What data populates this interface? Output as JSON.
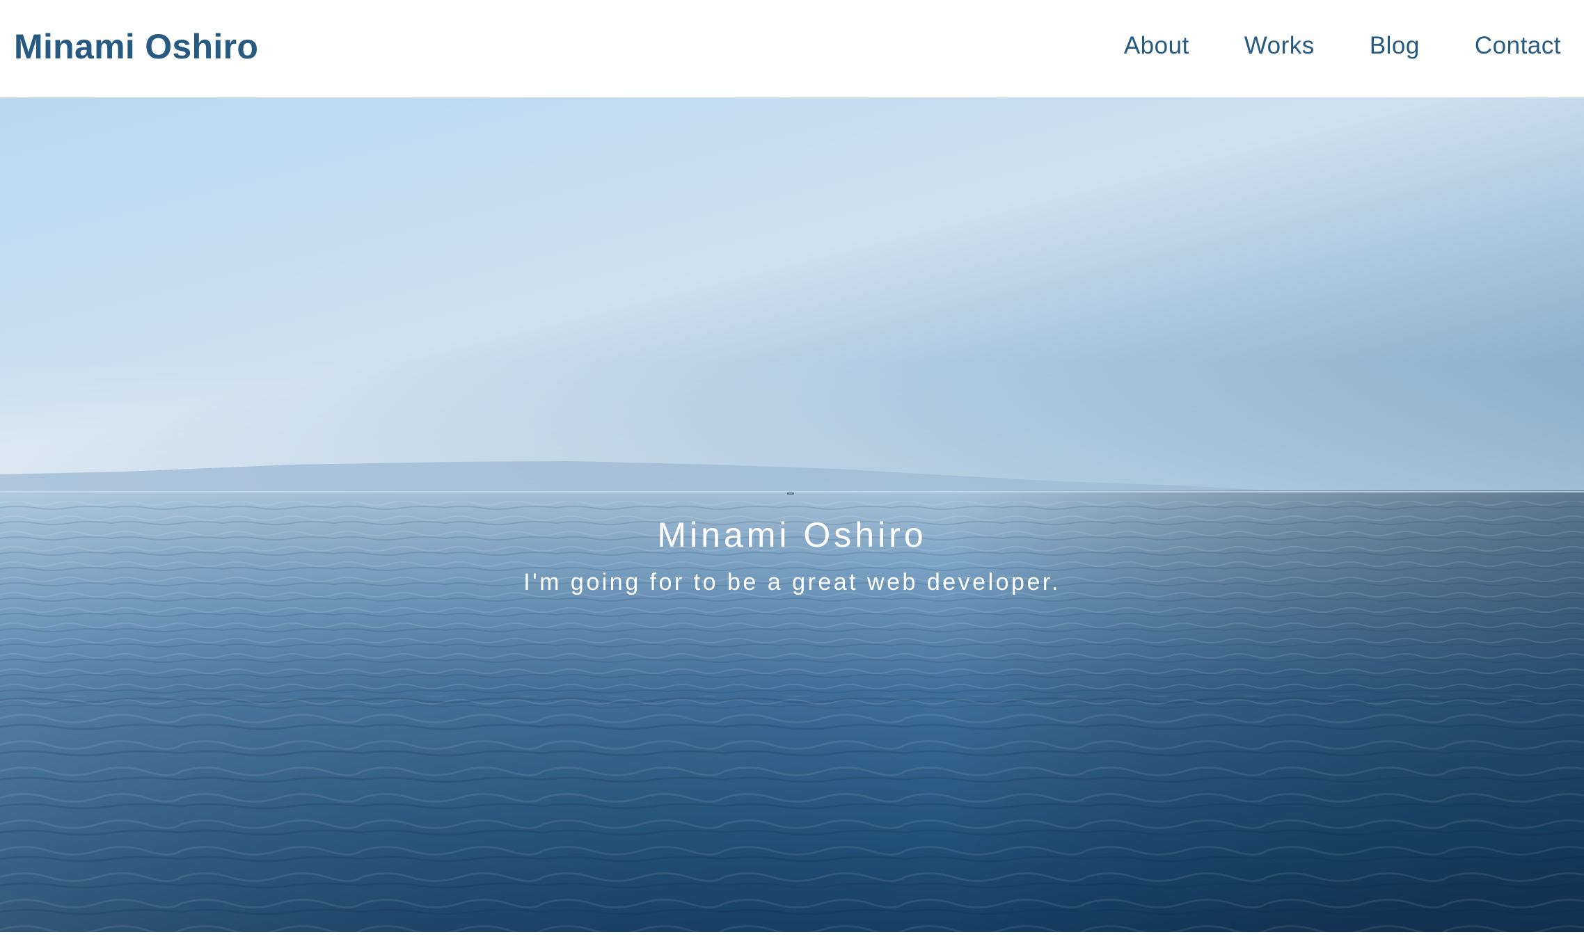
{
  "header": {
    "brand": "Minami Oshiro",
    "nav": [
      {
        "label": "About"
      },
      {
        "label": "Works"
      },
      {
        "label": "Blog"
      },
      {
        "label": "Contact"
      }
    ]
  },
  "hero": {
    "title": "Minami Oshiro",
    "tagline": "I'm going for to be a great web developer.",
    "image_description": "calm-sea-horizon"
  },
  "colors": {
    "brand": "#265a82",
    "nav_text": "#265a82",
    "hero_text": "#ffffff",
    "sky_light": "#dbe7f2",
    "sea_deep": "#14395e"
  }
}
